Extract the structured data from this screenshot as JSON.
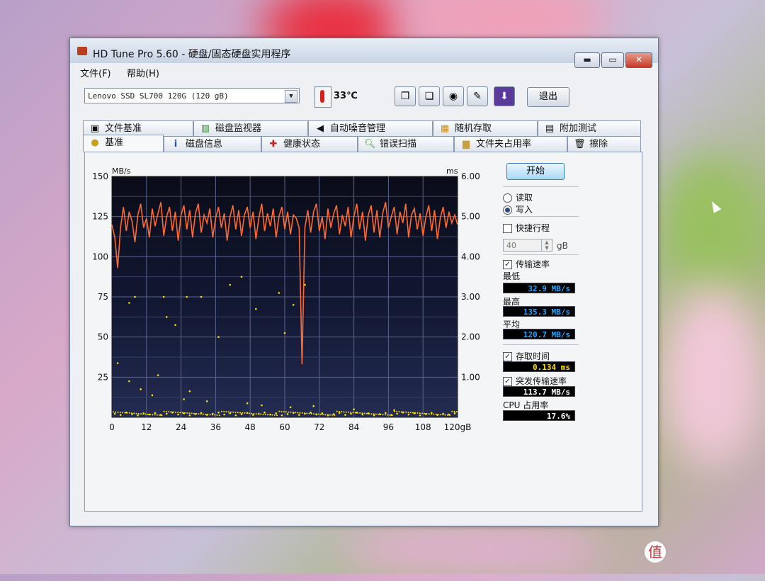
{
  "window": {
    "title": "HD Tune Pro 5.60 - 硬盘/固态硬盘实用程序"
  },
  "menu": {
    "file": "文件(F)",
    "help": "帮助(H)"
  },
  "toolbar": {
    "drive": "Lenovo SSD SL700 120G (120 gB)",
    "temperature": "33℃",
    "exit_label": "退出",
    "icons": [
      "copy-icon",
      "copy-text-icon",
      "camera-icon",
      "settings-icon",
      "save-icon"
    ]
  },
  "tabs_back": [
    "文件基准",
    "磁盘监视器",
    "自动噪音管理",
    "随机存取",
    "附加测试"
  ],
  "tabs_front": [
    "基准",
    "磁盘信息",
    "健康状态",
    "错误扫描",
    "文件夹占用率",
    "擦除"
  ],
  "controls": {
    "start": "开始",
    "read": "读取",
    "write": "写入",
    "mode_selected": "write",
    "quick": "快捷行程",
    "quick_checked": false,
    "quick_value": "40",
    "quick_unit": "gB",
    "transfer_rate": "传输速率",
    "transfer_checked": true,
    "min_label": "最低",
    "min_value": "32.9 MB/s",
    "max_label": "最高",
    "max_value": "135.3 MB/s",
    "avg_label": "平均",
    "avg_value": "120.7 MB/s",
    "access_label": "存取时间",
    "access_checked": true,
    "access_value": "0.134 ms",
    "burst_label": "突发传输速率",
    "burst_checked": true,
    "burst_value": "113.7 MB/s",
    "cpu_label": "CPU 占用率",
    "cpu_value": "17.6%"
  },
  "colors": {
    "transfer_line": "#ff6a30",
    "access_points": "#ffe000",
    "lcd_blue": "#20a8ff",
    "lcd_yellow": "#ffe000"
  },
  "chart_data": {
    "type": "line",
    "y_left_label": "MB/s",
    "y_right_label": "ms",
    "ylim": [
      0,
      150
    ],
    "y2lim": [
      0,
      6
    ],
    "xlim": [
      0,
      120
    ],
    "x_ticks": [
      "0",
      "12",
      "24",
      "36",
      "48",
      "60",
      "72",
      "84",
      "96",
      "108",
      "120gB"
    ],
    "y_ticks": [
      "150",
      "125",
      "100",
      "75",
      "50",
      "25"
    ],
    "y2_ticks": [
      "6.00",
      "5.00",
      "4.00",
      "3.00",
      "2.00",
      "1.00"
    ],
    "grid": true,
    "series": [
      {
        "values": [
          [
            0,
            120
          ],
          [
            1,
            112
          ],
          [
            2,
            93
          ],
          [
            3,
            118
          ],
          [
            4,
            131
          ],
          [
            5,
            116
          ],
          [
            6,
            128
          ],
          [
            7,
            122
          ],
          [
            8,
            109
          ],
          [
            9,
            126
          ],
          [
            10,
            133
          ],
          [
            11,
            118
          ],
          [
            12,
            124
          ],
          [
            13,
            112
          ],
          [
            14,
            130
          ],
          [
            15,
            119
          ],
          [
            16,
            127
          ],
          [
            17,
            134
          ],
          [
            18,
            113
          ],
          [
            19,
            125
          ],
          [
            20,
            131
          ],
          [
            21,
            116
          ],
          [
            22,
            128
          ],
          [
            23,
            110
          ],
          [
            24,
            126
          ],
          [
            25,
            132
          ],
          [
            26,
            117
          ],
          [
            27,
            129
          ],
          [
            28,
            112
          ],
          [
            29,
            127
          ],
          [
            30,
            133
          ],
          [
            31,
            115
          ],
          [
            32,
            126
          ],
          [
            33,
            121
          ],
          [
            34,
            130
          ],
          [
            35,
            112
          ],
          [
            36,
            124
          ],
          [
            37,
            131
          ],
          [
            38,
            118
          ],
          [
            39,
            127
          ],
          [
            40,
            110
          ],
          [
            41,
            125
          ],
          [
            42,
            132
          ],
          [
            43,
            117
          ],
          [
            44,
            129
          ],
          [
            45,
            113
          ],
          [
            46,
            126
          ],
          [
            47,
            131
          ],
          [
            48,
            118
          ],
          [
            49,
            128
          ],
          [
            50,
            111
          ],
          [
            51,
            124
          ],
          [
            52,
            133
          ],
          [
            53,
            116
          ],
          [
            54,
            127
          ],
          [
            55,
            119
          ],
          [
            56,
            130
          ],
          [
            57,
            112
          ],
          [
            58,
            125
          ],
          [
            59,
            131
          ],
          [
            60,
            117
          ],
          [
            61,
            128
          ],
          [
            62,
            114
          ],
          [
            63,
            126
          ],
          [
            64,
            124
          ],
          [
            65,
            118
          ],
          [
            66,
            33
          ],
          [
            67,
            118
          ],
          [
            68,
            129
          ],
          [
            69,
            115
          ],
          [
            70,
            128
          ],
          [
            71,
            133
          ],
          [
            72,
            116
          ],
          [
            73,
            125
          ],
          [
            74,
            111
          ],
          [
            75,
            130
          ],
          [
            76,
            118
          ],
          [
            77,
            127
          ],
          [
            78,
            132
          ],
          [
            79,
            114
          ],
          [
            80,
            126
          ],
          [
            81,
            119
          ],
          [
            82,
            131
          ],
          [
            83,
            112
          ],
          [
            84,
            125
          ],
          [
            85,
            133
          ],
          [
            86,
            117
          ],
          [
            87,
            128
          ],
          [
            88,
            110
          ],
          [
            89,
            126
          ],
          [
            90,
            132
          ],
          [
            91,
            115
          ],
          [
            92,
            129
          ],
          [
            93,
            112
          ],
          [
            94,
            127
          ],
          [
            95,
            134
          ],
          [
            96,
            118
          ],
          [
            97,
            125
          ],
          [
            98,
            131
          ],
          [
            99,
            114
          ],
          [
            100,
            128
          ],
          [
            101,
            121
          ],
          [
            102,
            133
          ],
          [
            103,
            112
          ],
          [
            104,
            126
          ],
          [
            105,
            130
          ],
          [
            106,
            117
          ],
          [
            107,
            127
          ],
          [
            108,
            113
          ],
          [
            109,
            125
          ],
          [
            110,
            132
          ],
          [
            111,
            116
          ],
          [
            112,
            129
          ],
          [
            113,
            111
          ],
          [
            114,
            124
          ],
          [
            115,
            131
          ],
          [
            116,
            118
          ],
          [
            117,
            128
          ],
          [
            118,
            121
          ],
          [
            119,
            126
          ],
          [
            120,
            120
          ]
        ]
      },
      {
        "values": [
          [
            1,
            0.09
          ],
          [
            3,
            0.06
          ],
          [
            5,
            0.12
          ],
          [
            7,
            0.08
          ],
          [
            9,
            0.05
          ],
          [
            11,
            0.1
          ],
          [
            13,
            0.07
          ],
          [
            15,
            0.11
          ],
          [
            17,
            0.06
          ],
          [
            19,
            0.09
          ],
          [
            21,
            0.12
          ],
          [
            23,
            0.07
          ],
          [
            25,
            0.1
          ],
          [
            27,
            0.05
          ],
          [
            29,
            0.08
          ],
          [
            31,
            0.11
          ],
          [
            33,
            0.06
          ],
          [
            35,
            0.09
          ],
          [
            37,
            0.12
          ],
          [
            39,
            0.07
          ],
          [
            41,
            0.1
          ],
          [
            43,
            0.05
          ],
          [
            45,
            0.08
          ],
          [
            47,
            0.11
          ],
          [
            49,
            0.06
          ],
          [
            51,
            0.09
          ],
          [
            53,
            0.12
          ],
          [
            55,
            0.07
          ],
          [
            57,
            0.1
          ],
          [
            59,
            0.05
          ],
          [
            61,
            0.08
          ],
          [
            63,
            0.11
          ],
          [
            65,
            0.06
          ],
          [
            67,
            0.09
          ],
          [
            69,
            0.12
          ],
          [
            71,
            0.07
          ],
          [
            73,
            0.1
          ],
          [
            75,
            0.05
          ],
          [
            77,
            0.08
          ],
          [
            79,
            0.11
          ],
          [
            81,
            0.06
          ],
          [
            83,
            0.09
          ],
          [
            85,
            0.12
          ],
          [
            87,
            0.07
          ],
          [
            89,
            0.1
          ],
          [
            91,
            0.05
          ],
          [
            93,
            0.08
          ],
          [
            95,
            0.11
          ],
          [
            97,
            0.06
          ],
          [
            99,
            0.09
          ],
          [
            101,
            0.12
          ],
          [
            103,
            0.07
          ],
          [
            105,
            0.1
          ],
          [
            107,
            0.05
          ],
          [
            109,
            0.08
          ],
          [
            111,
            0.11
          ],
          [
            113,
            0.06
          ],
          [
            115,
            0.09
          ],
          [
            117,
            0.07
          ],
          [
            119,
            0.1
          ],
          [
            2,
            1.35
          ],
          [
            6,
            2.85
          ],
          [
            8,
            3.0
          ],
          [
            18,
            3.0
          ],
          [
            19,
            2.5
          ],
          [
            22,
            2.3
          ],
          [
            26,
            3.0
          ],
          [
            31,
            3.0
          ],
          [
            37,
            2.0
          ],
          [
            41,
            3.3
          ],
          [
            45,
            3.5
          ],
          [
            50,
            2.7
          ],
          [
            58,
            3.1
          ],
          [
            60,
            2.1
          ],
          [
            63,
            2.8
          ],
          [
            67,
            3.3
          ],
          [
            6,
            0.9
          ],
          [
            10,
            0.7
          ],
          [
            14,
            0.55
          ],
          [
            16,
            1.05
          ],
          [
            25,
            0.45
          ],
          [
            27,
            0.65
          ],
          [
            33,
            0.4
          ],
          [
            47,
            0.35
          ],
          [
            52,
            0.3
          ],
          [
            62,
            0.25
          ],
          [
            70,
            0.28
          ],
          [
            84,
            0.2
          ],
          [
            98,
            0.18
          ]
        ]
      }
    ]
  }
}
